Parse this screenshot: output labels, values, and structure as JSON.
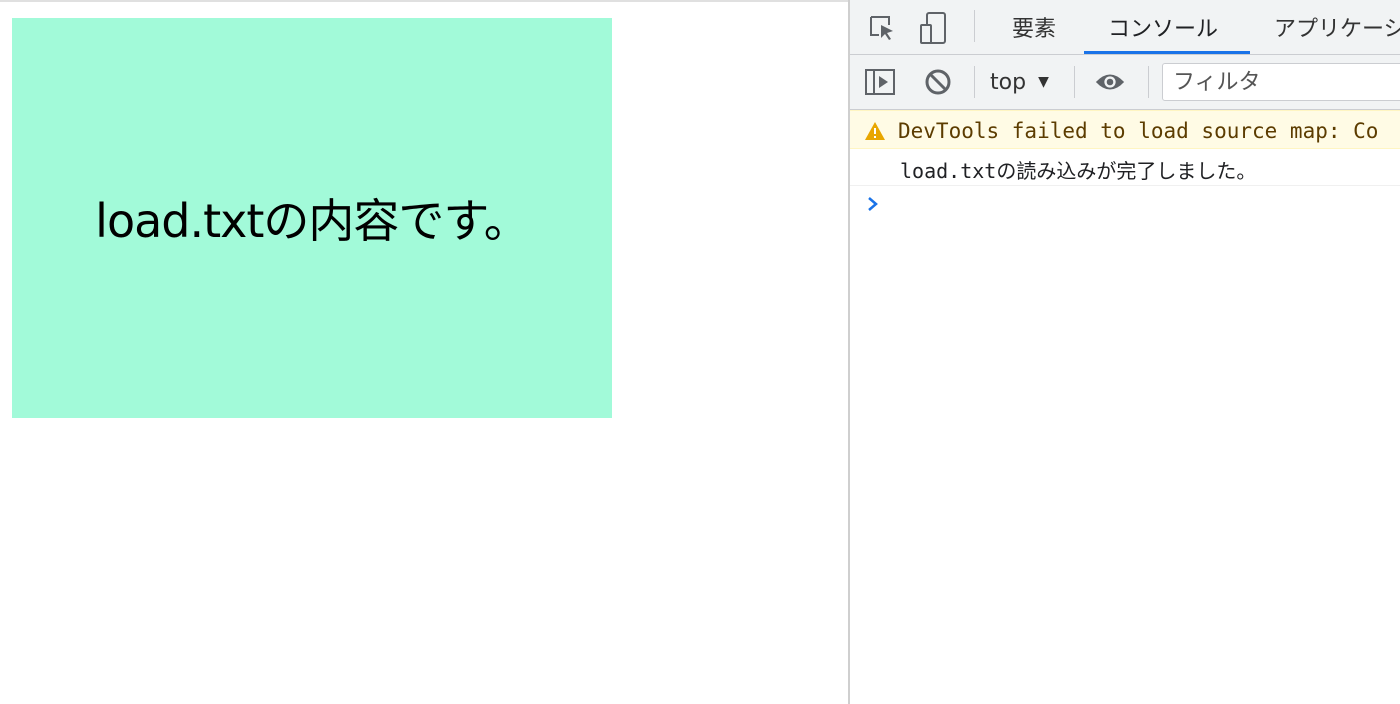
{
  "page": {
    "content_text": "load.txtの内容です。"
  },
  "devtools": {
    "tabs": [
      {
        "label": "要素"
      },
      {
        "label": "コンソール"
      },
      {
        "label": "アプリケーシ"
      }
    ],
    "active_tab": "コンソール",
    "toolbar": {
      "context": "top",
      "filter_placeholder": "フィルタ"
    },
    "console": {
      "warning": "DevTools failed to load source map: Co",
      "log": "load.txtの読み込みが完了しました。"
    }
  },
  "colors": {
    "content_bg": "#a2fad9",
    "accent": "#1a73e8",
    "warning_bg": "#fffbe5",
    "warning_icon": "#e8a600"
  },
  "icons": [
    "inspect-element-icon",
    "device-toggle-icon",
    "sidebar-toggle-icon",
    "clear-console-icon",
    "live-expression-eye-icon",
    "warning-icon",
    "prompt-chevron-icon"
  ]
}
